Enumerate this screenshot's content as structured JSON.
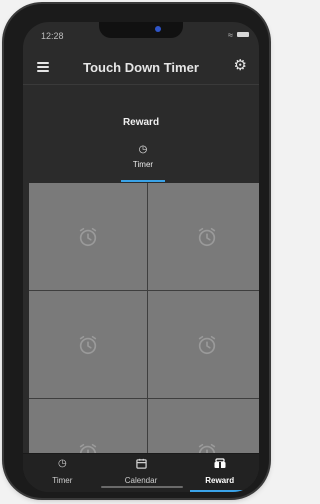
{
  "status_bar": {
    "time": "12:28",
    "wifi_icon": "wifi-icon",
    "battery_icon": "battery-icon"
  },
  "app_bar": {
    "title": "Touch Down Timer",
    "menu_icon": "hamburger-menu-icon",
    "settings_icon": "gear-icon"
  },
  "page": {
    "title": "Reward"
  },
  "tabs": [
    {
      "label": "Timer",
      "icon": "timer-icon",
      "active": true
    }
  ],
  "grid": {
    "item_icon": "alarm-clock-icon",
    "visible_cells": 6
  },
  "bottom_nav": [
    {
      "label": "Timer",
      "icon": "timer-icon",
      "active": false
    },
    {
      "label": "Calendar",
      "icon": "calendar-icon",
      "active": false
    },
    {
      "label": "Reward",
      "icon": "reward-icon",
      "active": true
    }
  ],
  "colors": {
    "accent": "#3aa3e8",
    "background": "#2b2b2b",
    "tile": "#7a7a7a"
  }
}
